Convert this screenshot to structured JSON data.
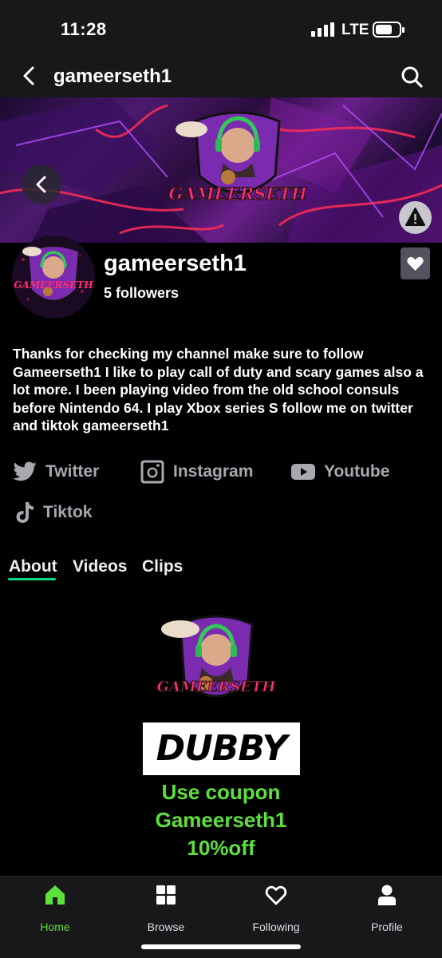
{
  "status_bar": {
    "time": "11:28",
    "network": "LTE",
    "battery_level": 0.7
  },
  "header": {
    "title": "gameerseth1"
  },
  "banner": {
    "logo_text": "GAMEERSETH"
  },
  "profile": {
    "name": "gameerseth1",
    "followers": "5 followers",
    "avatar_text": "GAMEERSETH",
    "bio": "Thanks for checking my channel make sure to follow Gameerseth1 I like to play call of duty and scary games also a lot more. I been playing video from the old school consuls before Nintendo 64. I play Xbox series S follow me on twitter and tiktok gameerseth1"
  },
  "social_links": [
    {
      "label": "Twitter",
      "icon": "twitter-icon"
    },
    {
      "label": "Instagram",
      "icon": "instagram-icon"
    },
    {
      "label": "Youtube",
      "icon": "youtube-icon"
    },
    {
      "label": "Tiktok",
      "icon": "tiktok-icon"
    }
  ],
  "tabs": [
    {
      "label": "About",
      "active": true
    },
    {
      "label": "Videos",
      "active": false
    },
    {
      "label": "Clips",
      "active": false
    }
  ],
  "about_panel": {
    "logo_text": "GAMEERSETH",
    "sponsor": "DUBBY",
    "coupon_lines": [
      "Use coupon",
      "Gameerseth1",
      "10%off"
    ]
  },
  "bottom_nav": [
    {
      "label": "Home",
      "icon": "home-icon",
      "active": true
    },
    {
      "label": "Browse",
      "icon": "browse-icon",
      "active": false
    },
    {
      "label": "Following",
      "icon": "heart-icon",
      "active": false
    },
    {
      "label": "Profile",
      "icon": "person-icon",
      "active": false
    }
  ],
  "colors": {
    "accent": "#00db84",
    "active_nav": "#5ee03c",
    "coupon": "#5ee03c",
    "nav_bg": "#18181b"
  }
}
